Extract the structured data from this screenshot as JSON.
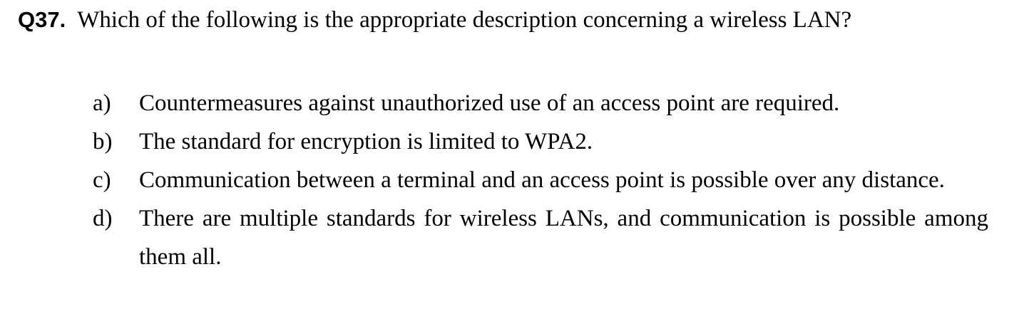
{
  "question": {
    "number": "Q37.",
    "text": "Which of the following is the appropriate description concerning a wireless LAN?"
  },
  "options": [
    {
      "label": "a)",
      "text": "Countermeasures against unauthorized use of an access point are required."
    },
    {
      "label": "b)",
      "text": "The standard for encryption is limited to WPA2."
    },
    {
      "label": "c)",
      "text": "Communication between a terminal and an access point is possible over any distance."
    },
    {
      "label": "d)",
      "text": "There are multiple standards for wireless LANs, and communication is possible among them all."
    }
  ]
}
